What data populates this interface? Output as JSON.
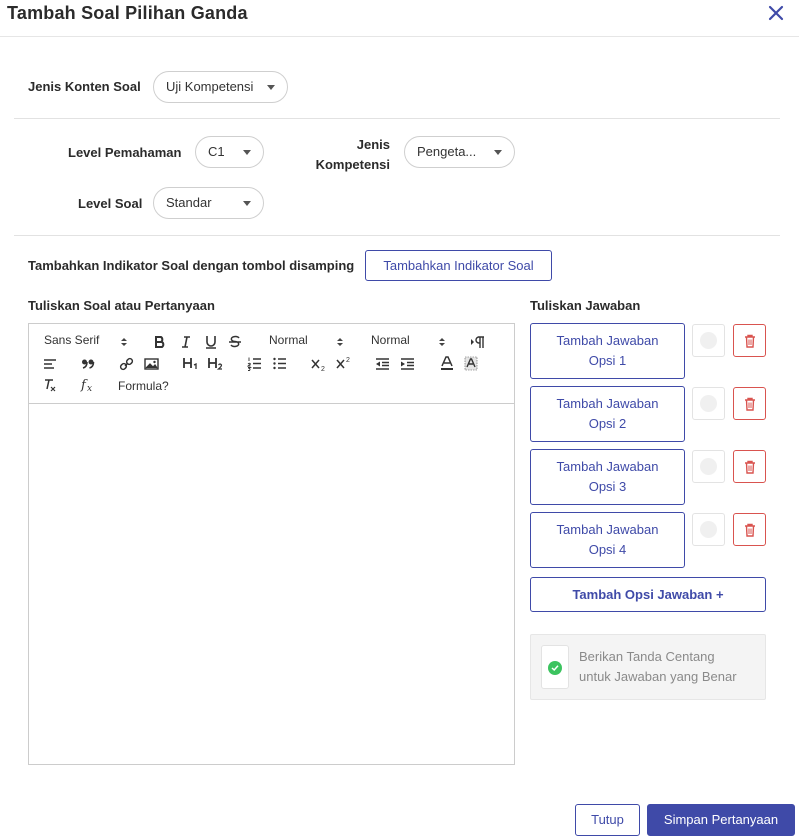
{
  "dialog": {
    "title": "Tambah Soal Pilihan Ganda"
  },
  "jenis_konten": {
    "label": "Jenis Konten Soal",
    "value": "Uji Kompetensi"
  },
  "level_pemahaman": {
    "label": "Level Pemahaman",
    "value": "C1"
  },
  "jenis_kompetensi": {
    "label_line1": "Jenis",
    "label_line2": "Kompetensi",
    "value": "Pengeta..."
  },
  "level_soal": {
    "label": "Level Soal",
    "value": "Standar"
  },
  "indikator": {
    "label": "Tambahkan Indikator Soal dengan tombol disamping",
    "button": "Tambahkan Indikator Soal"
  },
  "question": {
    "label": "Tuliskan Soal atau Pertanyaan",
    "toolbar": {
      "font": "Sans Serif",
      "size": "Normal",
      "header": "Normal",
      "formula": "Formula?"
    }
  },
  "answers": {
    "label": "Tuliskan Jawaban",
    "options": [
      {
        "line1": "Tambah Jawaban",
        "line2": "Opsi 1"
      },
      {
        "line1": "Tambah Jawaban",
        "line2": "Opsi 2"
      },
      {
        "line1": "Tambah Jawaban",
        "line2": "Opsi 3"
      },
      {
        "line1": "Tambah Jawaban",
        "line2": "Opsi 4"
      }
    ],
    "add_option": "Tambah Opsi Jawaban +",
    "hint_line1": "Berikan Tanda Centang",
    "hint_line2": "untuk Jawaban yang Benar"
  },
  "footer": {
    "close": "Tutup",
    "save": "Simpan Pertanyaan"
  },
  "colors": {
    "primary": "#3f4aa8",
    "danger": "#d9534f",
    "success": "#3cc35f"
  }
}
